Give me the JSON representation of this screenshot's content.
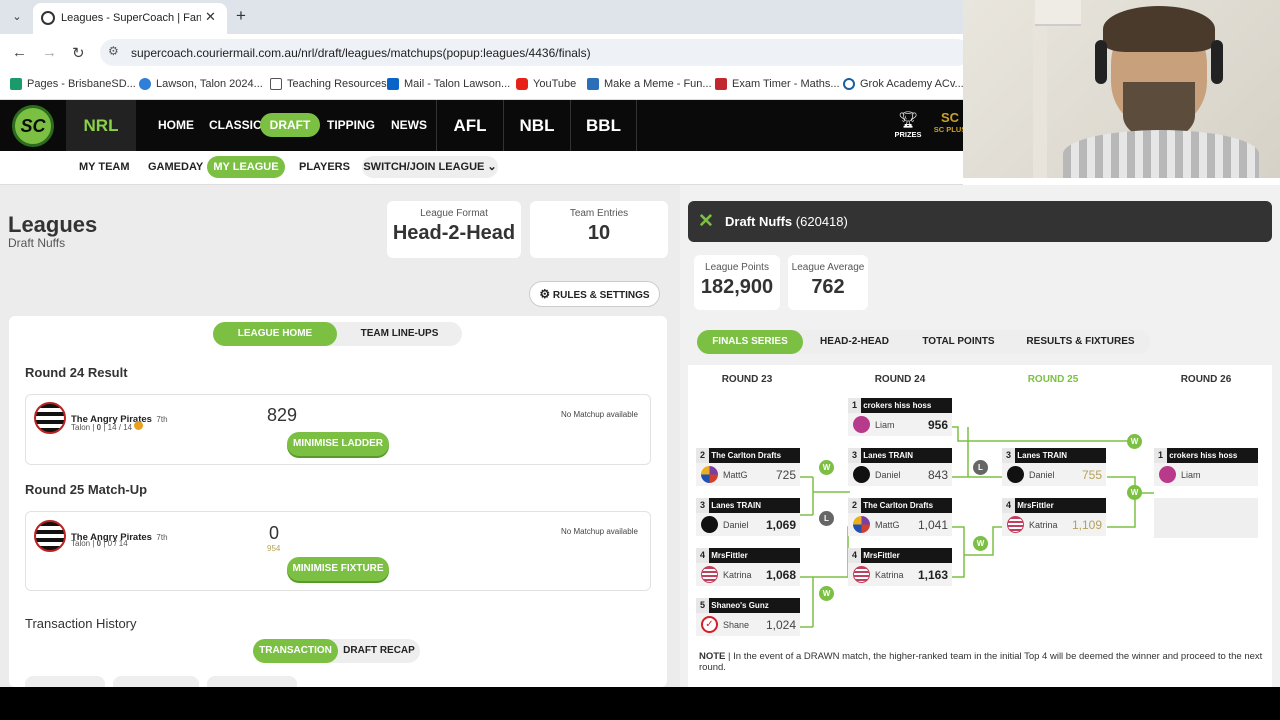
{
  "browser": {
    "tab_title": "Leagues - SuperCoach | Fantasy",
    "url": "supercoach.couriermail.com.au/nrl/draft/leagues/matchups(popup:leagues/4436/finals)",
    "bookmarks": [
      "Pages - BrisbaneSD...",
      "Lawson, Talon 2024...",
      "Teaching Resources",
      "Mail - Talon Lawson...",
      "YouTube",
      "Make a Meme - Fun...",
      "Exam Timer - Maths...",
      "Grok Academy ACv..."
    ]
  },
  "header": {
    "logo": "SC",
    "nrl": "NRL",
    "nav": [
      "HOME",
      "CLASSIC",
      "DRAFT",
      "TIPPING",
      "NEWS"
    ],
    "sports": [
      "AFL",
      "NBL",
      "BBL"
    ],
    "prizes": "PRIZES",
    "scplus": "SC PLUS"
  },
  "subnav": {
    "items": [
      "MY TEAM",
      "GAMEDAY",
      "MY LEAGUE",
      "PLAYERS"
    ],
    "switch": "SWITCH/JOIN LEAGUE"
  },
  "left": {
    "title": "Leagues",
    "subtitle": "Draft Nuffs",
    "format_label": "League Format",
    "format_value": "Head-2-Head",
    "entries_label": "Team Entries",
    "entries_value": "10",
    "rules": "RULES & SETTINGS",
    "tabs": [
      "LEAGUE HOME",
      "TEAM LINE-UPS"
    ],
    "r24_title": "Round 24 Result",
    "r24": {
      "team": "The Angry Pirates",
      "rank": "7th",
      "coach": "Talon |",
      "n0": "0",
      "rest": "| 14 / 14",
      "score": "829",
      "nomatch": "No Matchup available",
      "btn": "MINIMISE LADDER"
    },
    "r25_title": "Round 25 Match-Up",
    "r25": {
      "team": "The Angry Pirates",
      "rank": "7th",
      "coach": "Talon |",
      "n0": "0",
      "rest": "| 0 / 14",
      "score": "0",
      "proj": "954",
      "nomatch": "No Matchup available",
      "btn": "MINIMISE FIXTURE"
    },
    "tx_title": "Transaction History",
    "tx_tabs": [
      "TRANSACTION",
      "DRAFT RECAP"
    ]
  },
  "right": {
    "league_name": "Draft Nuffs",
    "league_id": "(620418)",
    "points_label": "League Points",
    "points_value": "182,900",
    "avg_label": "League Average",
    "avg_value": "762",
    "tabs": [
      "FINALS SERIES",
      "HEAD-2-HEAD",
      "TOTAL POINTS",
      "RESULTS & FIXTURES"
    ],
    "rounds": [
      "ROUND 23",
      "ROUND 24",
      "ROUND 25",
      "ROUND 26"
    ],
    "note_bold": "NOTE",
    "note": " | In the event of a DRAWN match, the higher-ranked team in the initial Top 4 will be deemed the winner and proceed to the next round."
  },
  "bracket": [
    {
      "seed": "2",
      "team": "The Carlton Drafts",
      "coach": "MattG",
      "score": "725",
      "color": "#7a3fa0"
    },
    {
      "seed": "3",
      "team": "Lanes TRAIN",
      "coach": "Daniel",
      "score": "1,069",
      "color": "#111"
    },
    {
      "seed": "4",
      "team": "MrsFittler",
      "coach": "Katrina",
      "score": "1,068",
      "color": "#c04060"
    },
    {
      "seed": "5",
      "team": "Shaneo's Gunz",
      "coach": "Shane",
      "score": "1,024",
      "color": "#d0202a"
    },
    {
      "seed": "1",
      "team": "crokers hiss hoss",
      "coach": "Liam",
      "score": "956",
      "color": "#b83a8a"
    },
    {
      "seed": "3",
      "team": "Lanes TRAIN",
      "coach": "Daniel",
      "score": "843",
      "color": "#111"
    },
    {
      "seed": "2",
      "team": "The Carlton Drafts",
      "coach": "MattG",
      "score": "1,041",
      "color": "#7a3fa0"
    },
    {
      "seed": "4",
      "team": "MrsFittler",
      "coach": "Katrina",
      "score": "1,163",
      "color": "#c04060"
    },
    {
      "seed": "3",
      "team": "Lanes TRAIN",
      "coach": "Daniel",
      "score": "755",
      "color": "#111"
    },
    {
      "seed": "4",
      "team": "MrsFittler",
      "coach": "Katrina",
      "score": "1,109",
      "color": "#c04060"
    },
    {
      "seed": "1",
      "team": "crokers hiss hoss",
      "coach": "Liam",
      "score": "",
      "color": "#b83a8a"
    }
  ],
  "colors": {
    "accent": "#7bc043",
    "dark": "#0a0a0a",
    "gold": "#b5a15a"
  }
}
